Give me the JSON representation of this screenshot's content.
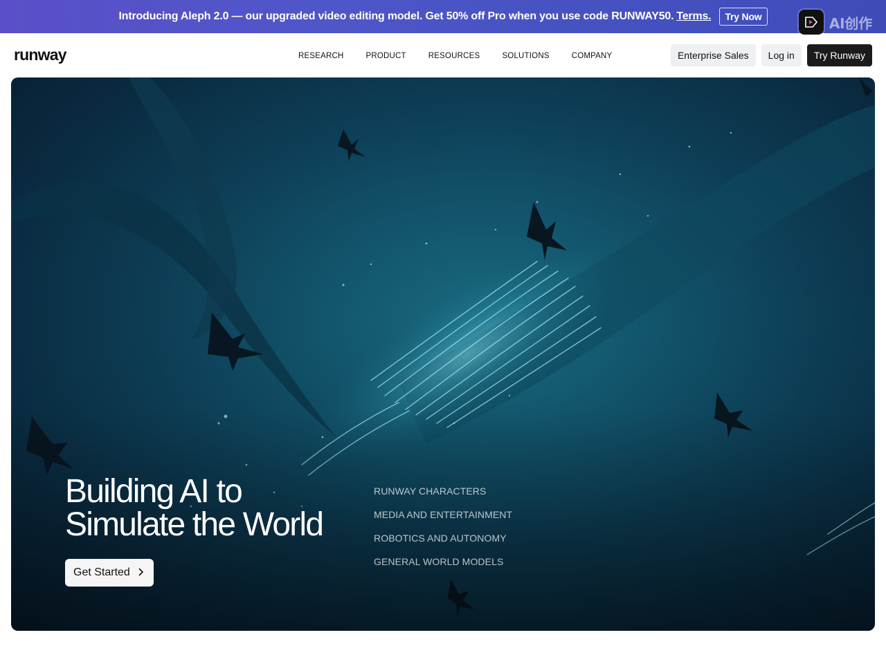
{
  "announcement": {
    "message": "Introducing Aleph 2.0 — our upgraded video editing model. Get 50% off Pro when you use code RUNWAY50.",
    "terms_label": "Terms.",
    "cta_label": "Try Now"
  },
  "watermark": {
    "icon": "app-logo-icon",
    "text": "AI创作"
  },
  "nav": {
    "brand": "runway",
    "menu": [
      "RESEARCH",
      "PRODUCT",
      "RESOURCES",
      "SOLUTIONS",
      "COMPANY"
    ],
    "actions": {
      "enterprise": "Enterprise Sales",
      "login": "Log in",
      "try": "Try Runway"
    }
  },
  "hero": {
    "title_line1": "Building AI to",
    "title_line2": "Simulate the World",
    "cta_label": "Get Started",
    "cta_icon": "chevron-right-icon",
    "links": [
      "RUNWAY CHARACTERS",
      "MEDIA AND ENTERTAINMENT",
      "ROBOTICS AND AUTONOMY",
      "GENERAL WORLD MODELS"
    ]
  },
  "colors": {
    "announce_bg": "#4f56c9",
    "hero_bg": "#0d3f57",
    "dark_button": "#1b1b1b",
    "light_button": "#eef0f3"
  }
}
